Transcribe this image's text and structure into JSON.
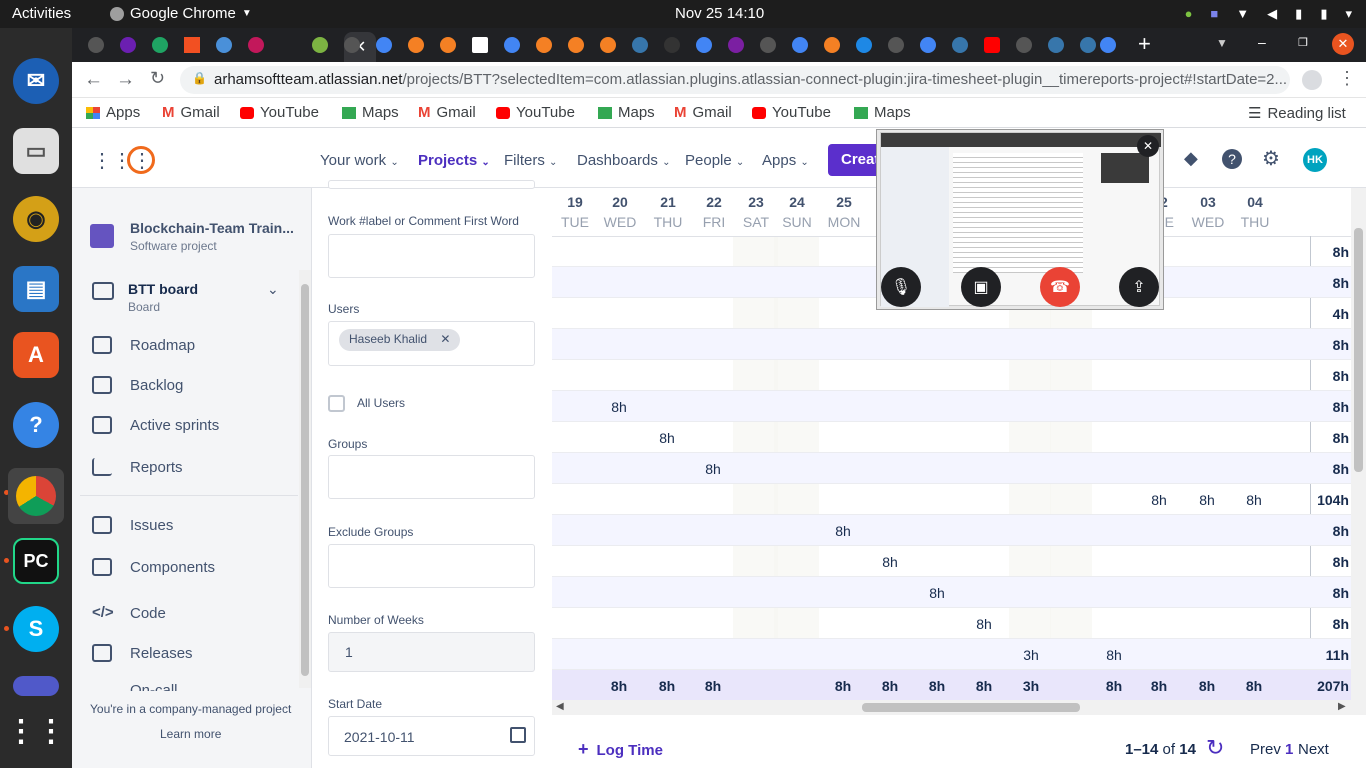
{
  "system": {
    "activities": "Activities",
    "app_name": "Google Chrome",
    "clock": "Nov 25  14:10"
  },
  "browser": {
    "url_host": "arhamsoftteam.atlassian.net",
    "url_path": "/projects/BTT?selectedItem=com.atlassian.plugins.atlassian-connect-plugin:jira-timesheet-plugin__timereports-project#!startDate=2...",
    "bookmarks": [
      "Apps",
      "Gmail",
      "YouTube",
      "Maps",
      "Gmail",
      "YouTube",
      "Maps",
      "Gmail",
      "YouTube",
      "Maps"
    ],
    "reading_list": "Reading list"
  },
  "jira_nav": {
    "items": [
      "Your work",
      "Projects",
      "Filters",
      "Dashboards",
      "People",
      "Apps"
    ],
    "create": "Create",
    "avatar": "HK"
  },
  "sidebar": {
    "project_name": "Blockchain-Team Train...",
    "project_type": "Software project",
    "board_name": "BTT board",
    "board_sub": "Board",
    "items": [
      "Roadmap",
      "Backlog",
      "Active sprints",
      "Reports",
      "Issues",
      "Components",
      "Code",
      "Releases",
      "On-call"
    ],
    "footer_text": "You're in a company-managed project",
    "learn_more": "Learn more"
  },
  "filters": {
    "work_label": "Work #label or Comment First Word",
    "users_label": "Users",
    "user_chip": "Haseeb Khalid",
    "all_users": "All Users",
    "groups_label": "Groups",
    "exclude_groups_label": "Exclude Groups",
    "weeks_label": "Number of Weeks",
    "weeks_value": "1",
    "start_date_label": "Start Date",
    "start_date_value": "2021-10-11"
  },
  "grid": {
    "days": [
      {
        "num": "19",
        "dow": "TUE"
      },
      {
        "num": "20",
        "dow": "WED"
      },
      {
        "num": "21",
        "dow": "THU"
      },
      {
        "num": "22",
        "dow": "FRI"
      },
      {
        "num": "23",
        "dow": "SAT"
      },
      {
        "num": "24",
        "dow": "SUN"
      },
      {
        "num": "25",
        "dow": "MON"
      },
      {
        "num": "",
        "dow": ""
      },
      {
        "num": "",
        "dow": ""
      },
      {
        "num": "",
        "dow": ""
      },
      {
        "num": "",
        "dow": ""
      },
      {
        "num": "",
        "dow": ""
      },
      {
        "num": "1",
        "dow": "ON"
      },
      {
        "num": "02",
        "dow": "TUE"
      },
      {
        "num": "03",
        "dow": "WED"
      },
      {
        "num": "04",
        "dow": "THU"
      }
    ],
    "rows": [
      {
        "cells": {},
        "total": "8h"
      },
      {
        "cells": {},
        "total": "8h"
      },
      {
        "cells": {},
        "total": "4h"
      },
      {
        "cells": {},
        "total": "8h"
      },
      {
        "cells": {},
        "total": "8h"
      },
      {
        "cells": {
          "1": "8h"
        },
        "total": "8h"
      },
      {
        "cells": {
          "2": "8h"
        },
        "total": "8h"
      },
      {
        "cells": {
          "3": "8h"
        },
        "total": "8h"
      },
      {
        "cells": {
          "13": "8h",
          "14": "8h",
          "15": "8h"
        },
        "total": "104h"
      },
      {
        "cells": {
          "6": "8h"
        },
        "total": "8h"
      },
      {
        "cells": {
          "7": "8h"
        },
        "total": "8h"
      },
      {
        "cells": {
          "8": "8h"
        },
        "total": "8h"
      },
      {
        "cells": {
          "9": "8h"
        },
        "total": "8h"
      },
      {
        "cells": {
          "10": "3h",
          "12": "8h"
        },
        "total": "11h"
      }
    ],
    "totals_row": {
      "cells": {
        "1": "8h",
        "2": "8h",
        "3": "8h",
        "6": "8h",
        "7": "8h",
        "8": "8h",
        "9": "8h",
        "10": "3h",
        "12": "8h",
        "13": "8h",
        "14": "8h",
        "15": "8h"
      },
      "total": "207h"
    }
  },
  "footer": {
    "log_time": "Log Time",
    "range": "1–14",
    "of": "of",
    "count": "14",
    "prev": "Prev",
    "page": "1",
    "next": "Next"
  },
  "colors": {
    "accent": "#5b2fcc",
    "selected_nav": "#4c2fbf",
    "end_call": "#ea4335"
  }
}
